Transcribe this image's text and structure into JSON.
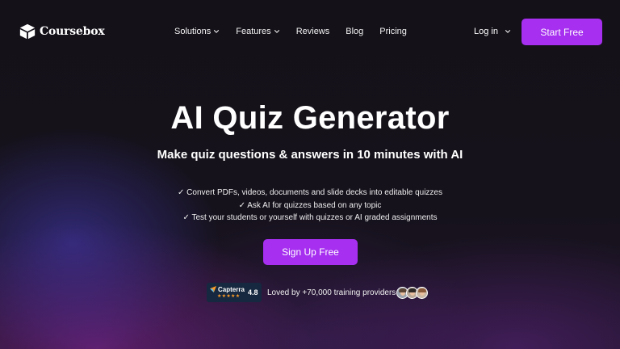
{
  "nav": {
    "logo_text": "Coursebox",
    "items": [
      {
        "label": "Solutions",
        "has_dropdown": true
      },
      {
        "label": "Features",
        "has_dropdown": true
      },
      {
        "label": "Reviews",
        "has_dropdown": false
      },
      {
        "label": "Blog",
        "has_dropdown": false
      },
      {
        "label": "Pricing",
        "has_dropdown": false
      }
    ],
    "login_label": "Log in",
    "start_label": "Start Free"
  },
  "hero": {
    "title": "AI Quiz Generator",
    "subtitle": "Make quiz questions & answers in 10 minutes with AI",
    "bullets": [
      "✓ Convert PDFs, videos, documents and slide decks into editable quizzes",
      "✓ Ask AI for quizzes based on any topic",
      "✓ Test your students or yourself with quizzes or AI graded assignments"
    ],
    "cta_label": "Sign Up Free"
  },
  "social_proof": {
    "capterra_name": "Capterra",
    "capterra_stars": "★★★★★",
    "capterra_score": "4.8",
    "loved_text": "Loved by +70,000 training providers"
  },
  "colors": {
    "accent": "#a62ff0",
    "background": "#131017",
    "capterra_badge": "#16283f",
    "star": "#ff9d28"
  },
  "icons": [
    "logo-cube-icon",
    "chevron-down-icon",
    "capterra-arrow-icon",
    "avatar-icon"
  ]
}
